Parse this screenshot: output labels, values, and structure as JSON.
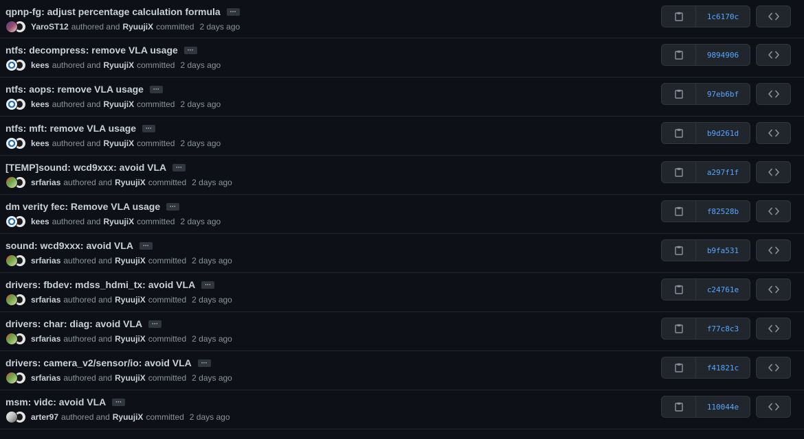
{
  "commits": [
    {
      "title": "qpnp-fg: adjust percentage calculation formula",
      "author": "YaroST12",
      "author_avatar": "av-yarost",
      "authored_text": "authored and",
      "committer": "RyuujiX",
      "committed_text": "committed",
      "time": "2 days ago",
      "sha": "1c6170c"
    },
    {
      "title": "ntfs: decompress: remove VLA usage",
      "author": "kees",
      "author_avatar": "av-kees",
      "authored_text": "authored and",
      "committer": "RyuujiX",
      "committed_text": "committed",
      "time": "2 days ago",
      "sha": "9894906"
    },
    {
      "title": "ntfs: aops: remove VLA usage",
      "author": "kees",
      "author_avatar": "av-kees",
      "authored_text": "authored and",
      "committer": "RyuujiX",
      "committed_text": "committed",
      "time": "2 days ago",
      "sha": "97eb6bf"
    },
    {
      "title": "ntfs: mft: remove VLA usage",
      "author": "kees",
      "author_avatar": "av-kees",
      "authored_text": "authored and",
      "committer": "RyuujiX",
      "committed_text": "committed",
      "time": "2 days ago",
      "sha": "b9d261d"
    },
    {
      "title": "[TEMP]sound: wcd9xxx: avoid VLA",
      "author": "srfarias",
      "author_avatar": "av-srfarias",
      "authored_text": "authored and",
      "committer": "RyuujiX",
      "committed_text": "committed",
      "time": "2 days ago",
      "sha": "a297f1f"
    },
    {
      "title": "dm verity fec: Remove VLA usage",
      "author": "kees",
      "author_avatar": "av-kees",
      "authored_text": "authored and",
      "committer": "RyuujiX",
      "committed_text": "committed",
      "time": "2 days ago",
      "sha": "f82528b"
    },
    {
      "title": "sound: wcd9xxx: avoid VLA",
      "author": "srfarias",
      "author_avatar": "av-srfarias",
      "authored_text": "authored and",
      "committer": "RyuujiX",
      "committed_text": "committed",
      "time": "2 days ago",
      "sha": "b9fa531"
    },
    {
      "title": "drivers: fbdev: mdss_hdmi_tx: avoid VLA",
      "author": "srfarias",
      "author_avatar": "av-srfarias",
      "authored_text": "authored and",
      "committer": "RyuujiX",
      "committed_text": "committed",
      "time": "2 days ago",
      "sha": "c24761e"
    },
    {
      "title": "drivers: char: diag: avoid VLA",
      "author": "srfarias",
      "author_avatar": "av-srfarias",
      "authored_text": "authored and",
      "committer": "RyuujiX",
      "committed_text": "committed",
      "time": "2 days ago",
      "sha": "f77c8c3"
    },
    {
      "title": "drivers: camera_v2/sensor/io: avoid VLA",
      "author": "srfarias",
      "author_avatar": "av-srfarias",
      "authored_text": "authored and",
      "committer": "RyuujiX",
      "committed_text": "committed",
      "time": "2 days ago",
      "sha": "f41821c"
    },
    {
      "title": "msm: vidc: avoid VLA",
      "author": "arter97",
      "author_avatar": "av-arter",
      "authored_text": "authored and",
      "committer": "RyuujiX",
      "committed_text": "committed",
      "time": "2 days ago",
      "sha": "110044e"
    }
  ],
  "ellipsis_label": "···",
  "colors": {
    "background": "#0d1117",
    "sha_link": "#58a6ff",
    "button_bg": "#21262d",
    "border": "#30363d"
  },
  "icons": {
    "copy": "clipboard-icon",
    "browse": "code-icon",
    "more": "ellipsis-icon"
  }
}
